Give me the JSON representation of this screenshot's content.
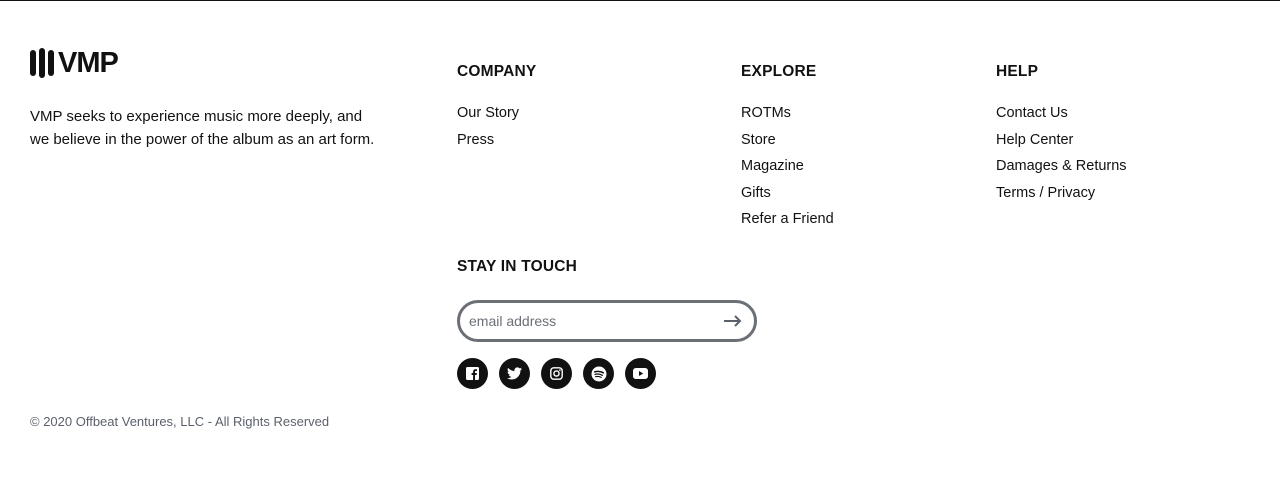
{
  "brand": {
    "logo_text": "VMP",
    "tagline": "VMP seeks to experience music more deeply, and we believe in the power of the album as an art form."
  },
  "company": {
    "heading": "COMPANY",
    "links": [
      "Our Story",
      "Press"
    ]
  },
  "explore": {
    "heading": "EXPLORE",
    "links": [
      "ROTMs",
      "Store",
      "Magazine",
      "Gifts",
      "Refer a Friend"
    ]
  },
  "help": {
    "heading": "HELP",
    "links": [
      "Contact Us",
      "Help Center",
      "Damages & Returns",
      "Terms / Privacy"
    ]
  },
  "newsletter": {
    "heading": "STAY IN TOUCH",
    "placeholder": "email address",
    "value": "",
    "submit_icon": "arrow-right-icon"
  },
  "socials": [
    "facebook-icon",
    "twitter-icon",
    "instagram-icon",
    "spotify-icon",
    "youtube-icon"
  ],
  "footer": {
    "copyright": "© 2020 Offbeat Ventures, LLC - All Rights Reserved"
  },
  "colors": {
    "text": "#111111",
    "muted": "#5b616b",
    "input_border": "#6b6f76",
    "background": "#ffffff"
  }
}
